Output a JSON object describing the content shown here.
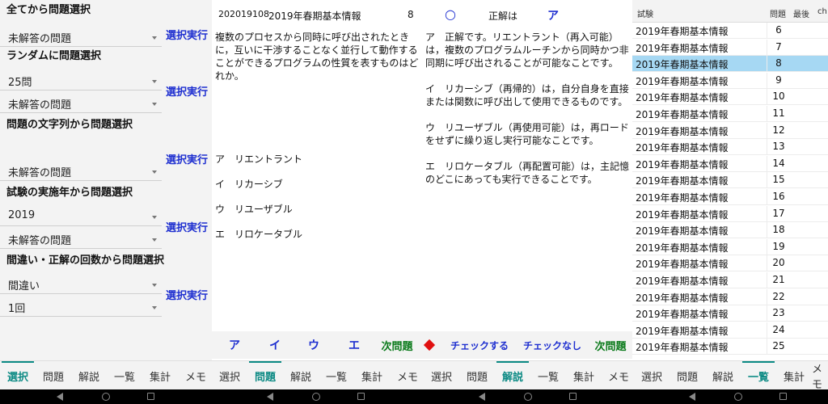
{
  "left": {
    "sec_all": "全てから問題選択",
    "sel_all": "未解答の問題",
    "exec_label": "選択実行",
    "sec_random": "ランダムに問題選択",
    "sel_count": "25問",
    "sel_random_status": "未解答の問題",
    "sec_string": "問題の文字列から問題選択",
    "sel_string_status": "未解答の問題",
    "sec_year": "試験の実施年から問題選択",
    "sel_year": "2019",
    "sel_year_status": "未解答の問題",
    "sec_count": "間違い・正解の回数から問題選択",
    "sel_mistake": "間違い",
    "sel_times": "1回"
  },
  "mid": {
    "code": "202019108",
    "exam": "2019年春期基本情報",
    "number": "8",
    "mark": "○",
    "answer_label": "正解は",
    "answer": "ア",
    "question": "複数のプロセスから同時に呼び出されたときに，互いに干渉することなく並行して動作することができるプログラムの性質を表すものはどれか。",
    "choices": [
      "ア　リエントラント",
      "イ　リカーシブ",
      "ウ　リユーザブル",
      "エ　リロケータブル"
    ],
    "explanation": [
      "ア　正解です。リエントラント（再入可能）は，複数のプログラムルーチンから同時かつ非同期に呼び出されることが可能なことです。",
      "イ　リカーシブ（再帰的）は，自分自身を直接または関数に呼び出して使用できるものです。",
      "ウ　リユーザブル（再使用可能）は，再ロードをせずに繰り返し実行可能なことです。",
      "エ　リロケータブル（再配置可能）は，主記憶のどこにあっても実行できることです。"
    ],
    "footer": {
      "a": "ア",
      "i": "イ",
      "u": "ウ",
      "e": "エ",
      "next": "次問題",
      "check": "チェックする",
      "nocheck": "チェックなし",
      "next2": "次問題"
    }
  },
  "right": {
    "head_exam": "試験",
    "head_q": "問題",
    "head_last": "最後",
    "head_ch": "ch",
    "rows": [
      {
        "exam": "2019年春期基本情報",
        "q": "6"
      },
      {
        "exam": "2019年春期基本情報",
        "q": "7"
      },
      {
        "exam": "2019年春期基本情報",
        "q": "8"
      },
      {
        "exam": "2019年春期基本情報",
        "q": "9"
      },
      {
        "exam": "2019年春期基本情報",
        "q": "10"
      },
      {
        "exam": "2019年春期基本情報",
        "q": "11"
      },
      {
        "exam": "2019年春期基本情報",
        "q": "12"
      },
      {
        "exam": "2019年春期基本情報",
        "q": "13"
      },
      {
        "exam": "2019年春期基本情報",
        "q": "14"
      },
      {
        "exam": "2019年春期基本情報",
        "q": "15"
      },
      {
        "exam": "2019年春期基本情報",
        "q": "16"
      },
      {
        "exam": "2019年春期基本情報",
        "q": "17"
      },
      {
        "exam": "2019年春期基本情報",
        "q": "18"
      },
      {
        "exam": "2019年春期基本情報",
        "q": "19"
      },
      {
        "exam": "2019年春期基本情報",
        "q": "20"
      },
      {
        "exam": "2019年春期基本情報",
        "q": "21"
      },
      {
        "exam": "2019年春期基本情報",
        "q": "22"
      },
      {
        "exam": "2019年春期基本情報",
        "q": "23"
      },
      {
        "exam": "2019年春期基本情報",
        "q": "24"
      },
      {
        "exam": "2019年春期基本情報",
        "q": "25"
      }
    ]
  },
  "tabs": {
    "g1": [
      "選択",
      "問題",
      "解説",
      "一覧",
      "集計",
      "メモ"
    ],
    "g2": [
      "選択",
      "問題",
      "解説",
      "一覧",
      "集計",
      "メモ"
    ],
    "g3": [
      "選択",
      "問題",
      "解説",
      "一覧",
      "集計",
      "メモ"
    ],
    "g4": [
      "選択",
      "問題",
      "解説",
      "一覧",
      "集計",
      "メモ"
    ]
  },
  "colors": {
    "accent": "#0c8a84",
    "link_blue": "#1e2fd0",
    "next_green": "#0a7a1a",
    "selected_row": "#a6d8f3",
    "diamond": "#e01010"
  }
}
